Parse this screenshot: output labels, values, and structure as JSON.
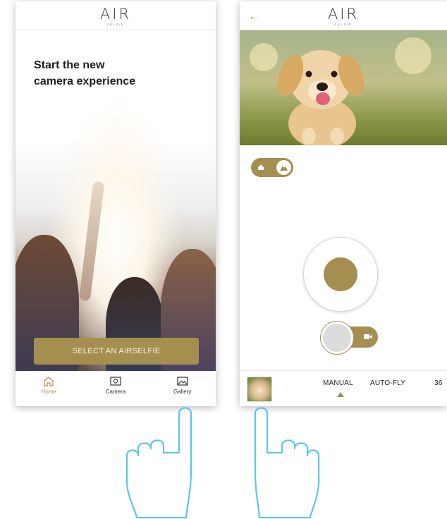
{
  "colors": {
    "accent": "#a58f50",
    "text": "#1f1f1f",
    "border": "#e6e6e6"
  },
  "left_screen": {
    "logo": {
      "main": "AIR",
      "sub": "SELFIE"
    },
    "headline_line1": "Start the new",
    "headline_line2": "camera experience",
    "select_button": "SELECT AN AIRSELFIE",
    "nav": [
      {
        "label": "Home",
        "icon": "home-icon",
        "active": true
      },
      {
        "label": "Camera",
        "icon": "camera-icon",
        "active": false
      },
      {
        "label": "Gallery",
        "icon": "gallery-icon",
        "active": false
      }
    ]
  },
  "right_screen": {
    "logo": {
      "main": "AIR",
      "sub": "SELFIE"
    },
    "back_icon": "back-arrow-icon",
    "toggle_icons": [
      "home-icon",
      "drone-icon"
    ],
    "shutter_mode_icon": "video-icon",
    "modes": [
      "MANUAL",
      "AUTO-FLY",
      "36"
    ],
    "selected_mode": "MANUAL"
  }
}
